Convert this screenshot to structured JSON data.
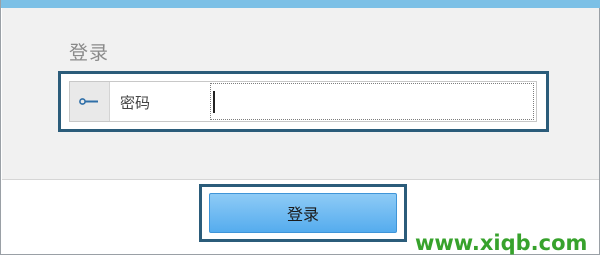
{
  "dialog": {
    "title": "登录"
  },
  "password": {
    "icon": "key-icon",
    "label": "密码",
    "value": ""
  },
  "login_button": {
    "label": "登录"
  },
  "watermark": {
    "text": "www.xiqb.com"
  },
  "colors": {
    "top_bar": "#7cc0e6",
    "panel_bg": "#f1f1f1",
    "highlight_border": "#2b5c7a",
    "button_top": "#8ecbf6",
    "button_bottom": "#55acee",
    "watermark": "#37a22c"
  }
}
